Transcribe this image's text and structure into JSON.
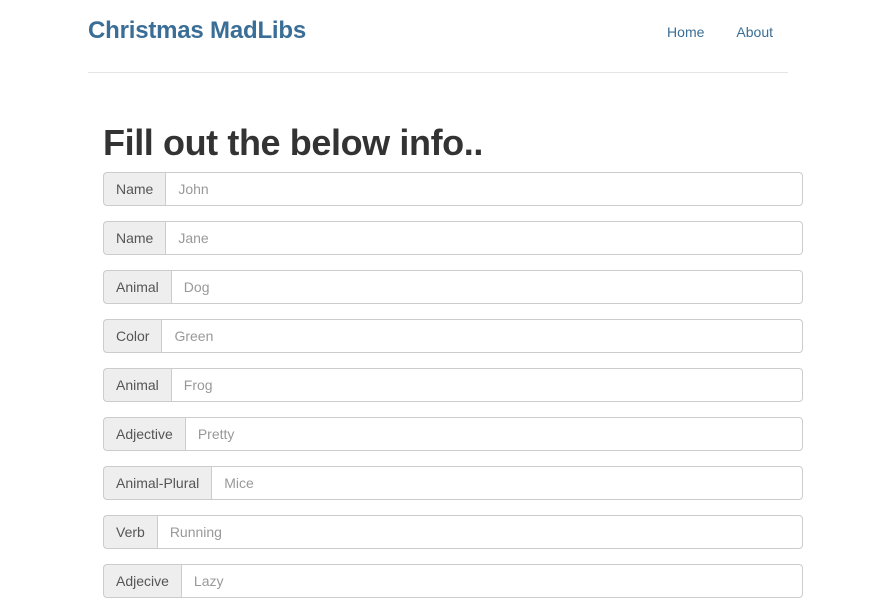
{
  "navbar": {
    "brand": "Christmas MadLibs",
    "links": [
      "Home",
      "About"
    ]
  },
  "main": {
    "heading": "Fill out the below info..",
    "fields": [
      {
        "label": "Name",
        "placeholder": "John"
      },
      {
        "label": "Name",
        "placeholder": "Jane"
      },
      {
        "label": "Animal",
        "placeholder": "Dog"
      },
      {
        "label": "Color",
        "placeholder": "Green"
      },
      {
        "label": "Animal",
        "placeholder": "Frog"
      },
      {
        "label": "Adjective",
        "placeholder": "Pretty"
      },
      {
        "label": "Animal-Plural",
        "placeholder": "Mice"
      },
      {
        "label": "Verb",
        "placeholder": "Running"
      },
      {
        "label": "Adjecive",
        "placeholder": "Lazy"
      }
    ]
  },
  "colors": {
    "brand": "#3a6e96",
    "link": "#3a6e96",
    "addon_background": "#eeeeee",
    "border": "#cccccc"
  }
}
